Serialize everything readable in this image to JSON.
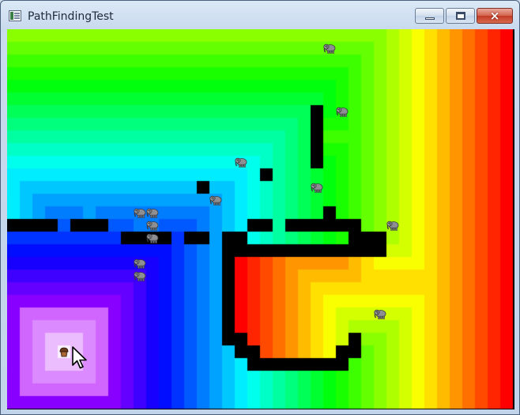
{
  "window": {
    "title": "PathFindingTest",
    "controls": {
      "minimize": "minimize",
      "maximize": "maximize",
      "close": "×"
    }
  },
  "game": {
    "grid": {
      "cols": 40,
      "rows": 30,
      "cell": 16
    },
    "wall_color": "#000000",
    "goal": {
      "col": 4,
      "row": 25
    },
    "walls": [
      [
        0,
        15
      ],
      [
        1,
        15
      ],
      [
        2,
        15
      ],
      [
        3,
        15
      ],
      [
        5,
        15
      ],
      [
        6,
        15
      ],
      [
        7,
        15
      ],
      [
        9,
        16
      ],
      [
        10,
        16
      ],
      [
        11,
        16
      ],
      [
        12,
        16
      ],
      [
        14,
        16
      ],
      [
        15,
        16
      ],
      [
        15,
        12
      ],
      [
        20,
        11
      ],
      [
        24,
        6
      ],
      [
        24,
        7
      ],
      [
        24,
        8
      ],
      [
        24,
        9
      ],
      [
        24,
        10
      ],
      [
        25,
        14
      ],
      [
        19,
        15
      ],
      [
        20,
        15
      ],
      [
        22,
        15
      ],
      [
        23,
        15
      ],
      [
        24,
        15
      ],
      [
        25,
        15
      ],
      [
        26,
        15
      ],
      [
        27,
        15
      ],
      [
        17,
        16
      ],
      [
        18,
        16
      ],
      [
        27,
        16
      ],
      [
        28,
        16
      ],
      [
        29,
        16
      ],
      [
        17,
        17
      ],
      [
        18,
        17
      ],
      [
        19,
        17
      ],
      [
        20,
        17
      ],
      [
        21,
        17
      ],
      [
        22,
        17
      ],
      [
        23,
        17
      ],
      [
        24,
        17
      ],
      [
        25,
        17
      ],
      [
        26,
        17
      ],
      [
        27,
        17
      ],
      [
        28,
        17
      ],
      [
        29,
        17
      ],
      [
        17,
        18
      ],
      [
        17,
        19
      ],
      [
        17,
        20
      ],
      [
        17,
        21
      ],
      [
        17,
        22
      ],
      [
        17,
        23
      ],
      [
        17,
        24
      ],
      [
        18,
        24
      ],
      [
        18,
        25
      ],
      [
        19,
        25
      ],
      [
        19,
        26
      ],
      [
        20,
        26
      ],
      [
        21,
        26
      ],
      [
        22,
        26
      ],
      [
        23,
        26
      ],
      [
        24,
        26
      ],
      [
        25,
        26
      ],
      [
        26,
        26
      ],
      [
        26,
        25
      ],
      [
        27,
        25
      ],
      [
        27,
        24
      ]
    ],
    "elephants": [
      [
        25,
        1
      ],
      [
        26,
        6
      ],
      [
        18,
        10
      ],
      [
        24,
        12
      ],
      [
        16,
        13
      ],
      [
        10,
        14
      ],
      [
        11,
        14
      ],
      [
        11,
        15
      ],
      [
        11,
        16
      ],
      [
        30,
        15
      ],
      [
        10,
        18
      ],
      [
        10,
        19
      ],
      [
        29,
        22
      ]
    ],
    "player": {
      "col": 4,
      "row": 25,
      "icon": "muffin-icon"
    },
    "cursor": "arrow-cursor-icon"
  }
}
